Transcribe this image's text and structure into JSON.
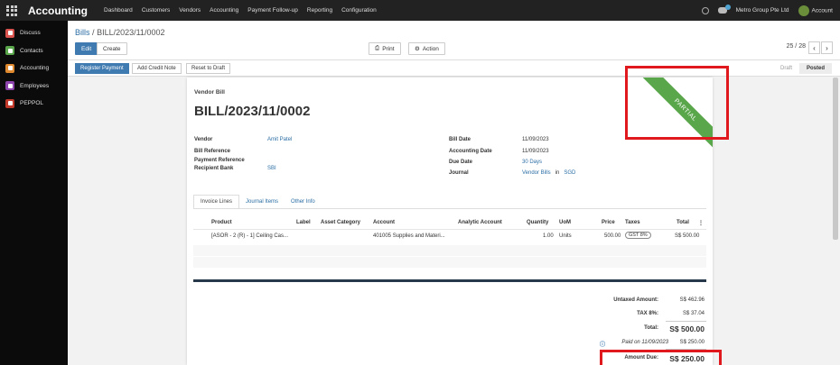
{
  "topbar": {
    "app_title": "Accounting",
    "nav": [
      "Dashboard",
      "Customers",
      "Vendors",
      "Accounting",
      "Payment Follow-up",
      "Reporting",
      "Configuration"
    ],
    "company": "Metro Group Pte Ltd",
    "user": "Account",
    "chat_badge": "2"
  },
  "sidebar": {
    "items": [
      {
        "label": "Discuss",
        "color": "#d9534f"
      },
      {
        "label": "Contacts",
        "color": "#5aa64a"
      },
      {
        "label": "Accounting",
        "color": "#e08a2f"
      },
      {
        "label": "Employees",
        "color": "#8e44ad"
      },
      {
        "label": "PEPPOL",
        "color": "#c0392b"
      }
    ]
  },
  "control": {
    "breadcrumb_parent": "Bills",
    "breadcrumb_sep": "/",
    "breadcrumb_current": "BILL/2023/11/0002",
    "edit": "Edit",
    "create": "Create",
    "print": "Print",
    "action": "Action",
    "pager": "25 / 28"
  },
  "statusbar": {
    "register_payment": "Register Payment",
    "add_credit_note": "Add Credit Note",
    "reset_to_draft": "Reset to Draft",
    "stage_draft": "Draft",
    "stage_posted": "Posted"
  },
  "sheet": {
    "doc_type": "Vendor Bill",
    "title": "BILL/2023/11/0002",
    "ribbon": "PARTIAL",
    "left_fields": [
      {
        "label": "Vendor",
        "value": "Amit Patel",
        "link": true
      },
      {
        "label": "Bill Reference",
        "value": "",
        "link": false
      },
      {
        "label": "Payment Reference",
        "value": "",
        "link": false
      },
      {
        "label": "Recipient Bank",
        "value": "SBI",
        "link": true
      }
    ],
    "right_fields": [
      {
        "label": "Bill Date",
        "value": "11/09/2023"
      },
      {
        "label": "Accounting Date",
        "value": "11/09/2023"
      },
      {
        "label": "Due Date",
        "value": "30 Days"
      },
      {
        "label": "Journal",
        "value": "Vendor Bills",
        "in": "in",
        "currency": "SGD"
      }
    ],
    "tabs": [
      "Invoice Lines",
      "Journal Items",
      "Other Info"
    ],
    "columns": [
      "Product",
      "Label",
      "Asset Category",
      "Account",
      "Analytic Account",
      "Quantity",
      "UoM",
      "Price",
      "Taxes",
      "Total"
    ],
    "line": {
      "product": "[ASOR - 2 (R) - 1] Ceiling Cas...",
      "account": "401005 Supplies and Materi...",
      "quantity": "1.00",
      "uom": "Units",
      "price": "500.00",
      "tax": "GST 8%",
      "total": "S$ 500.00"
    },
    "totals": {
      "untaxed_label": "Untaxed Amount:",
      "untaxed_value": "S$ 462.96",
      "tax_label": "TAX 8%:",
      "tax_value": "S$ 37.04",
      "total_label": "Total:",
      "total_value": "S$ 500.00",
      "paid_label": "Paid on 11/09/2023",
      "paid_value": "S$ 250.00",
      "due_label": "Amount Due:",
      "due_value": "S$ 250.00"
    }
  },
  "colors": {
    "accent": "#3f7ab0",
    "ribbon": "#5aa64a",
    "highlight": "#e0191f"
  }
}
